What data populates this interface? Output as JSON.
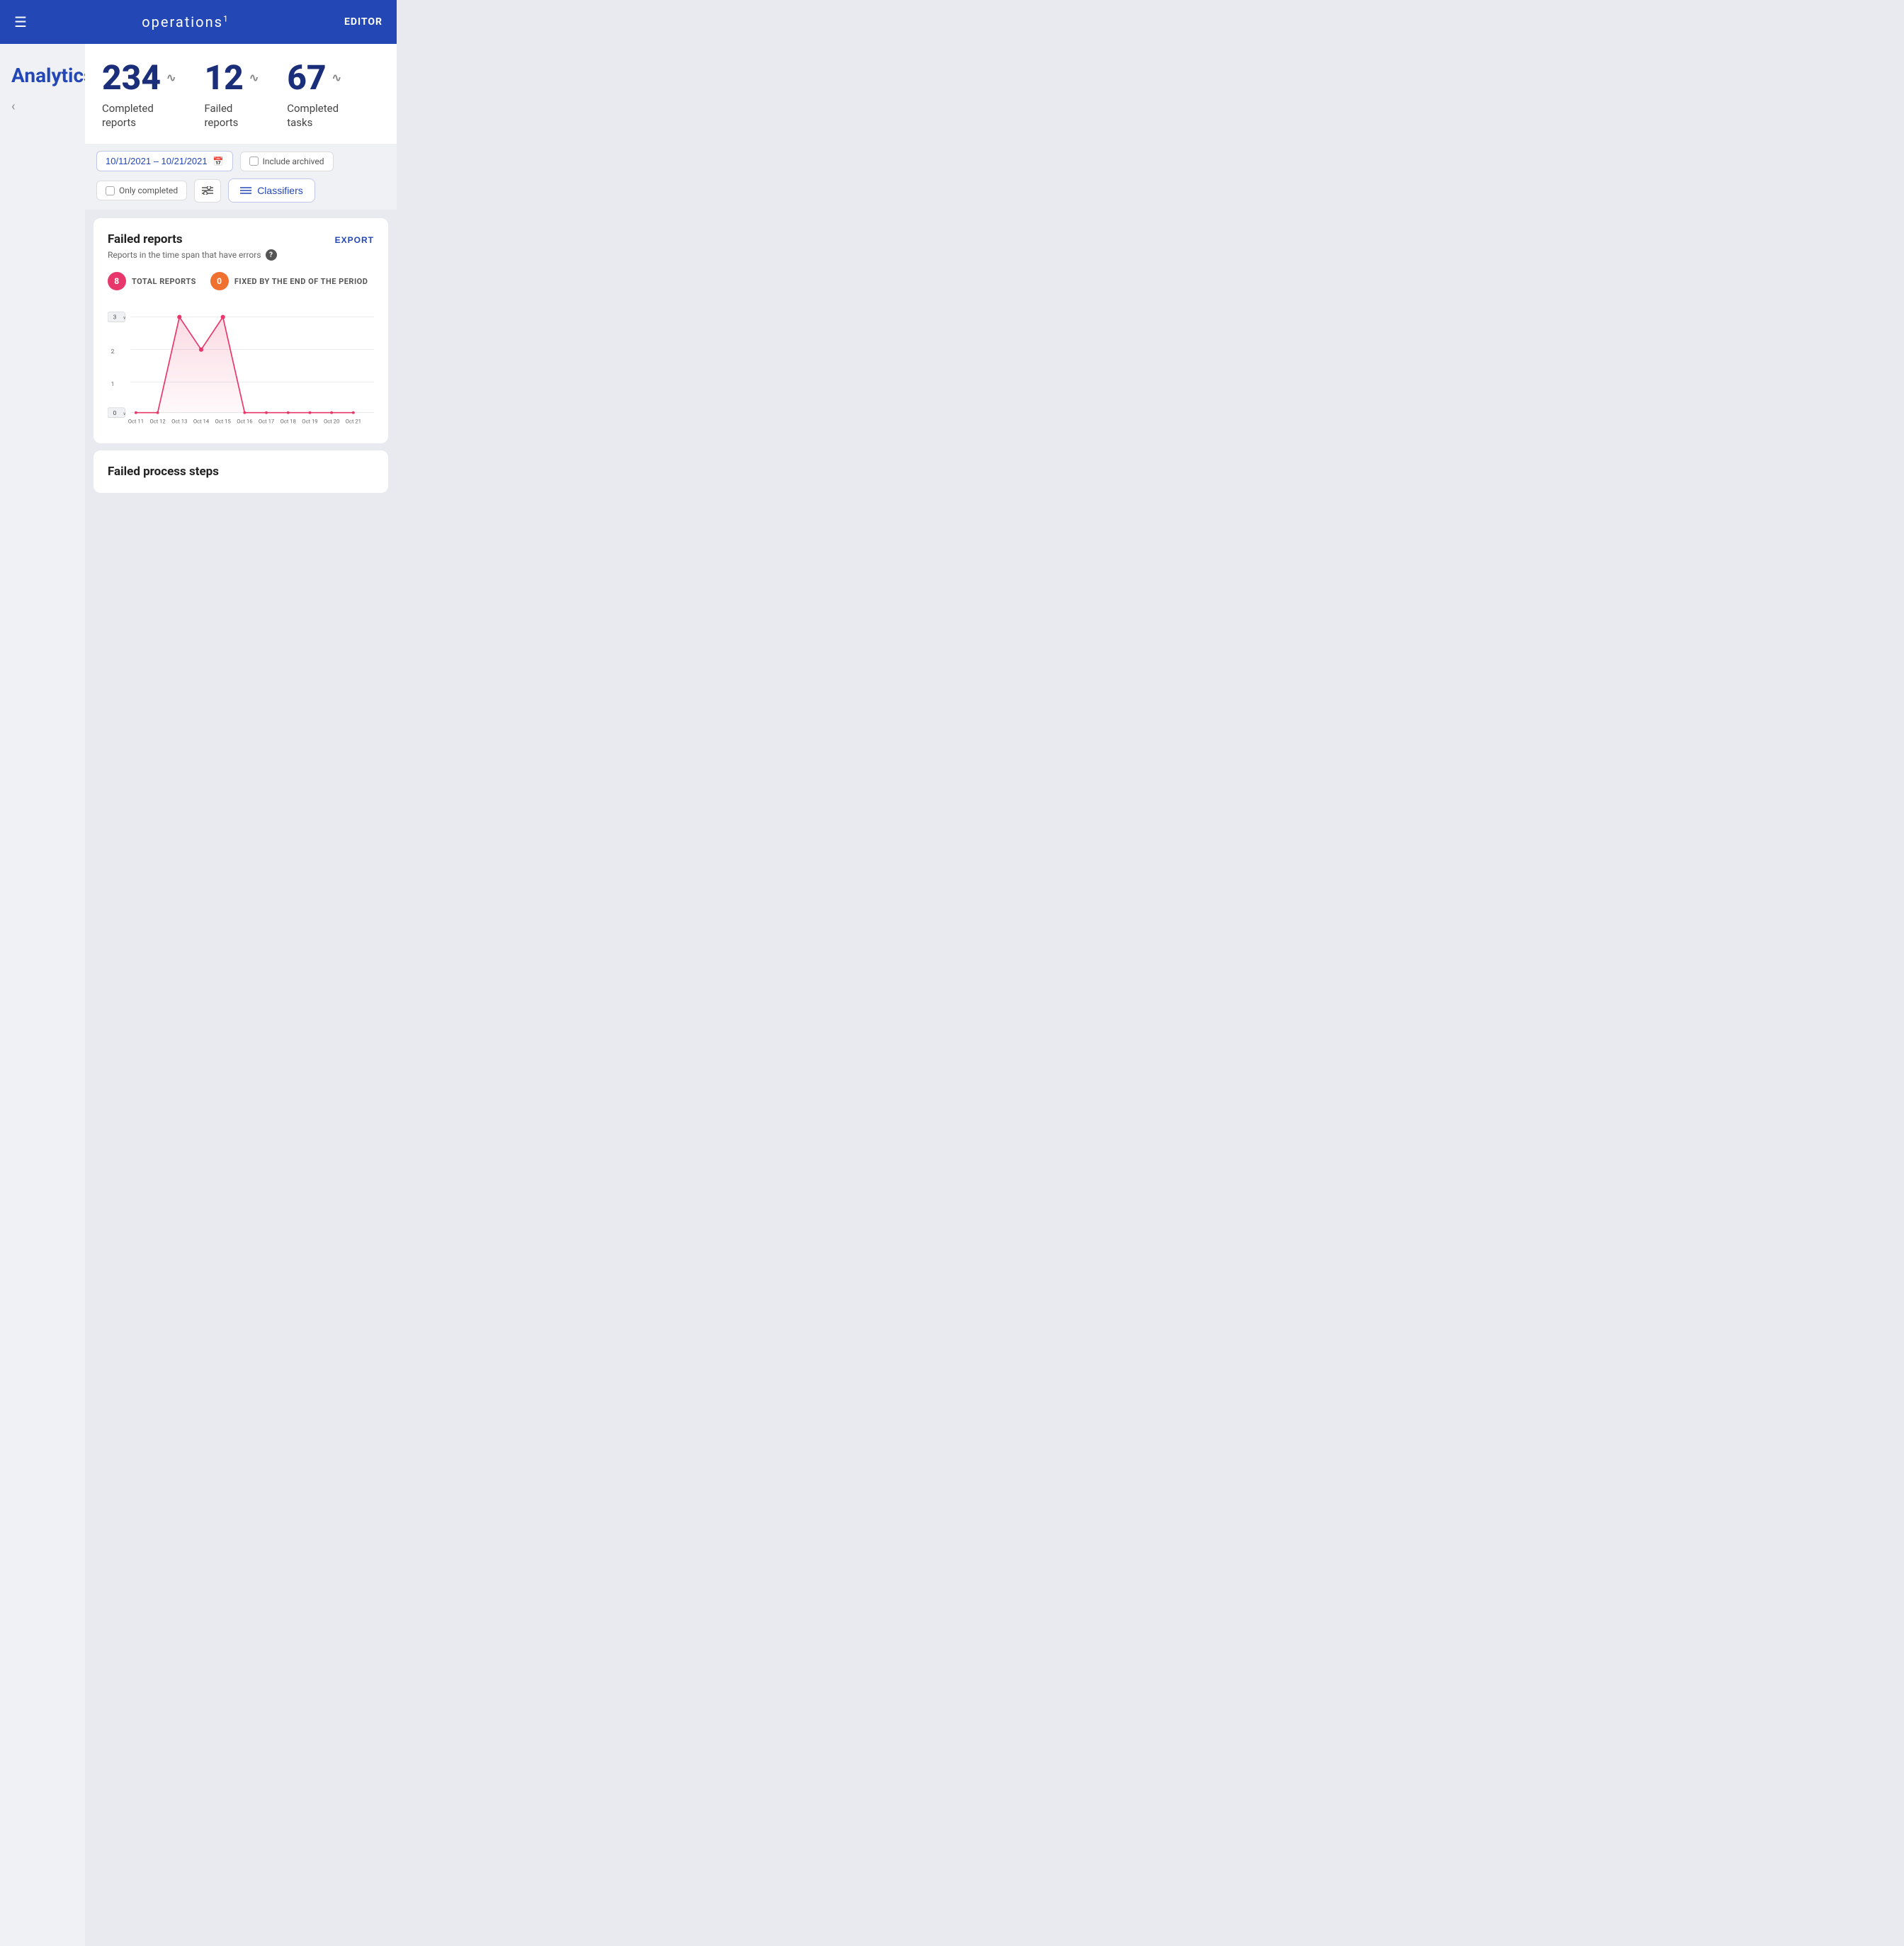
{
  "header": {
    "menu_icon": "☰",
    "title": "operations",
    "title_sup": "1",
    "editor_label": "EDITOR"
  },
  "sidebar": {
    "title": "Analytics",
    "back_icon": "‹"
  },
  "stats": [
    {
      "number": "234",
      "trend": "〜",
      "label": "Completed\nreports"
    },
    {
      "number": "12",
      "trend": "〜",
      "label": "Failed\nreports"
    },
    {
      "number": "67",
      "trend": "〜",
      "label": "Completed\ntasks"
    }
  ],
  "filters": {
    "date_range": "10/11/2021 – 10/21/2021",
    "include_archived": "Include archived",
    "only_completed": "Only completed",
    "classifiers_label": "Classifiers"
  },
  "chart": {
    "title": "Failed reports",
    "subtitle": "Reports in the time span that have errors",
    "export_label": "EXPORT",
    "legend": [
      {
        "label": "TOTAL REPORTS",
        "value": "8",
        "color": "#e8376b"
      },
      {
        "label": "FIXED BY THE END OF THE PERIOD",
        "value": "0",
        "color": "#f07030"
      }
    ],
    "y_max_label": "3",
    "y_min_label": "0",
    "x_labels": [
      "Oct 11",
      "Oct 12",
      "Oct 13",
      "Oct 14",
      "Oct 15",
      "Oct 16",
      "Oct 17",
      "Oct 18",
      "Oct 19",
      "Oct 20",
      "Oct 21"
    ],
    "y_labels": [
      "3",
      "2",
      "1"
    ],
    "data_points": [
      {
        "label": "Oct 11",
        "value": 0
      },
      {
        "label": "Oct 12",
        "value": 0
      },
      {
        "label": "Oct 13",
        "value": 3
      },
      {
        "label": "Oct 14",
        "value": 2
      },
      {
        "label": "Oct 15",
        "value": 3
      },
      {
        "label": "Oct 16",
        "value": 0
      },
      {
        "label": "Oct 17",
        "value": 0
      },
      {
        "label": "Oct 18",
        "value": 0
      },
      {
        "label": "Oct 19",
        "value": 0
      },
      {
        "label": "Oct 20",
        "value": 0
      },
      {
        "label": "Oct 21",
        "value": 0
      }
    ]
  },
  "bottom_card": {
    "title": "Failed process steps"
  }
}
